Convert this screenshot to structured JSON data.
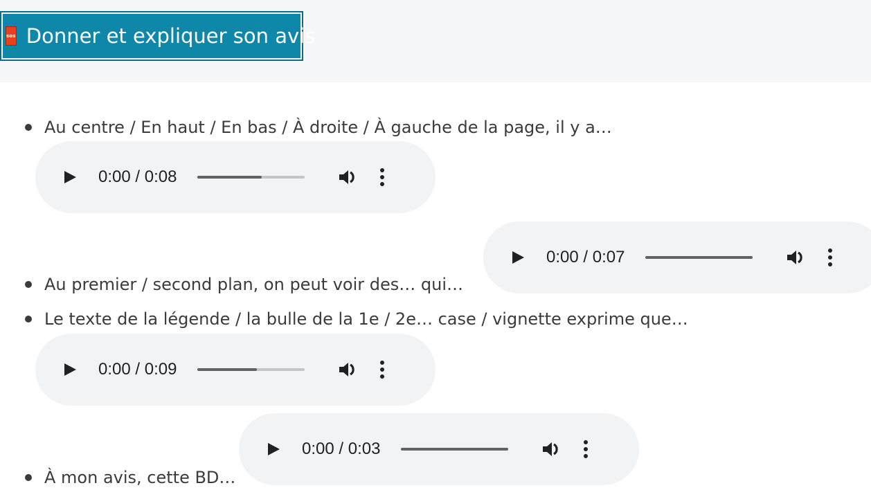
{
  "header": {
    "icon_label": "sos",
    "title": "Donner et expliquer son avis"
  },
  "items": [
    {
      "text": "Au centre / En haut / En bas / À droite / À gauche de la page, il y a…"
    },
    {
      "text": "Au premier / second plan, on peut voir des… qui…"
    },
    {
      "text": "Le texte de la légende / la bulle de la 1e / 2e… case / vignette exprime que…"
    },
    {
      "text": "À mon avis, cette BD…"
    }
  ],
  "players": [
    {
      "time": "0:00 / 0:08",
      "buffered": 0.6
    },
    {
      "time": "0:00 / 0:07",
      "buffered": 1.0
    },
    {
      "time": "0:00 / 0:09",
      "buffered": 0.55
    },
    {
      "time": "0:00 / 0:03",
      "buffered": 1.0
    }
  ],
  "colors": {
    "header_bg": "#0e87a8",
    "sos_icon": "#e8401c",
    "player_bg": "#f1f3f4"
  },
  "icons": {
    "play": "play-icon",
    "volume": "volume-icon",
    "menu": "more-vertical-icon"
  }
}
